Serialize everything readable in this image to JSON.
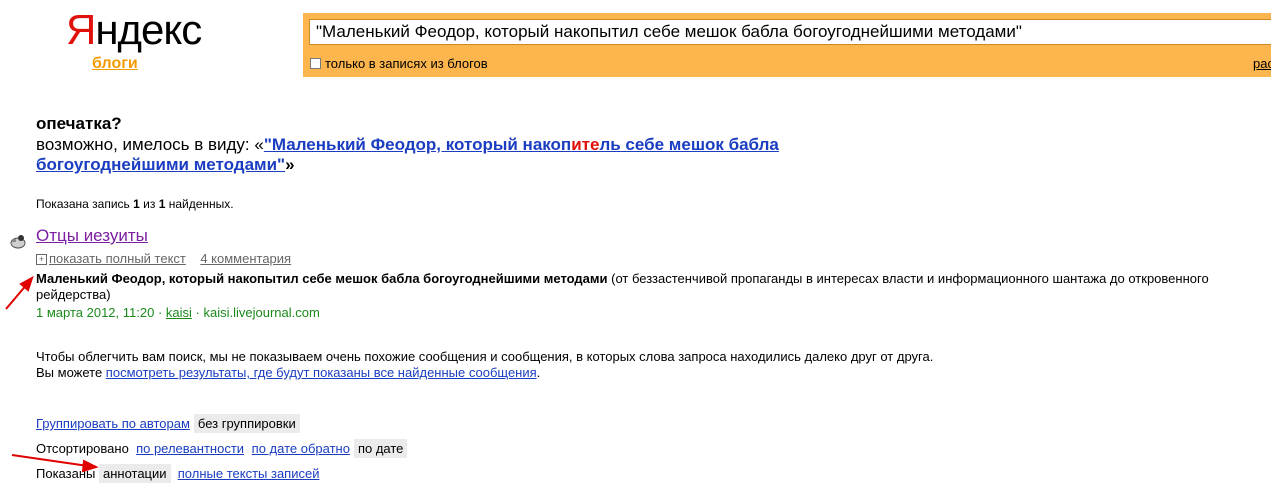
{
  "logo": {
    "first_letter": "Я",
    "rest": "ндекс",
    "service": "блоги"
  },
  "search": {
    "query": "\"Маленький Феодор, который накопытил себе мешок бабла богоугоднейшими методами\"",
    "blogs_only_label": "только в записях из блогов",
    "advanced_link": "рас"
  },
  "typo": {
    "heading": "опечатка?",
    "prefix": "возможно, имелось в виду: «",
    "suggest_part1": "\"Маленький Феодор, который накоп",
    "suggest_hl": "ите",
    "suggest_part2": "ль себе мешок бабла богоугоднейшими методами\"",
    "suffix": "»"
  },
  "results_count": {
    "prefix": "Показана запись ",
    "shown": "1",
    "middle": " из ",
    "total": "1",
    "suffix": " найденных."
  },
  "result": {
    "title": "Отцы иезуиты",
    "show_full": "показать полный текст",
    "comments": "4 комментария",
    "snippet_bold": "Маленький Феодор, который накопытил себе мешок бабла богоугоднейшими методами",
    "snippet_rest": " (от беззастенчивой пропаганды в интересах власти и информационного шантажа до откровенного рейдерства)",
    "date": "1 марта 2012, 11:20",
    "sep1": " · ",
    "author": "kaisi",
    "sep2": " · ",
    "source": "kaisi.livejournal.com"
  },
  "notice": {
    "line1": "Чтобы облегчить вам поиск, мы не показываем очень похожие сообщения и сообщения, в которых слова запроса находились далеко друг от друга.",
    "line2_prefix": "Вы можете ",
    "line2_link": "посмотреть результаты, где будут показаны все найденные сообщения",
    "line2_suffix": "."
  },
  "controls": {
    "group_link": "Группировать по авторам",
    "group_current": "без группировки",
    "sort_label": "Отсортировано",
    "sort_relevance": "по релевантности",
    "sort_date_reverse": "по дате обратно",
    "sort_date_current": "по дате",
    "shown_label": "Показаны",
    "shown_current": "аннотации",
    "shown_full": "полные тексты записей"
  },
  "colors": {
    "accent_orange": "#fdb54d",
    "link_blue": "#1a3dc1",
    "visited_purple": "#7b1fa2",
    "meta_green": "#1b8a1b",
    "arrow_red": "#e00000"
  }
}
